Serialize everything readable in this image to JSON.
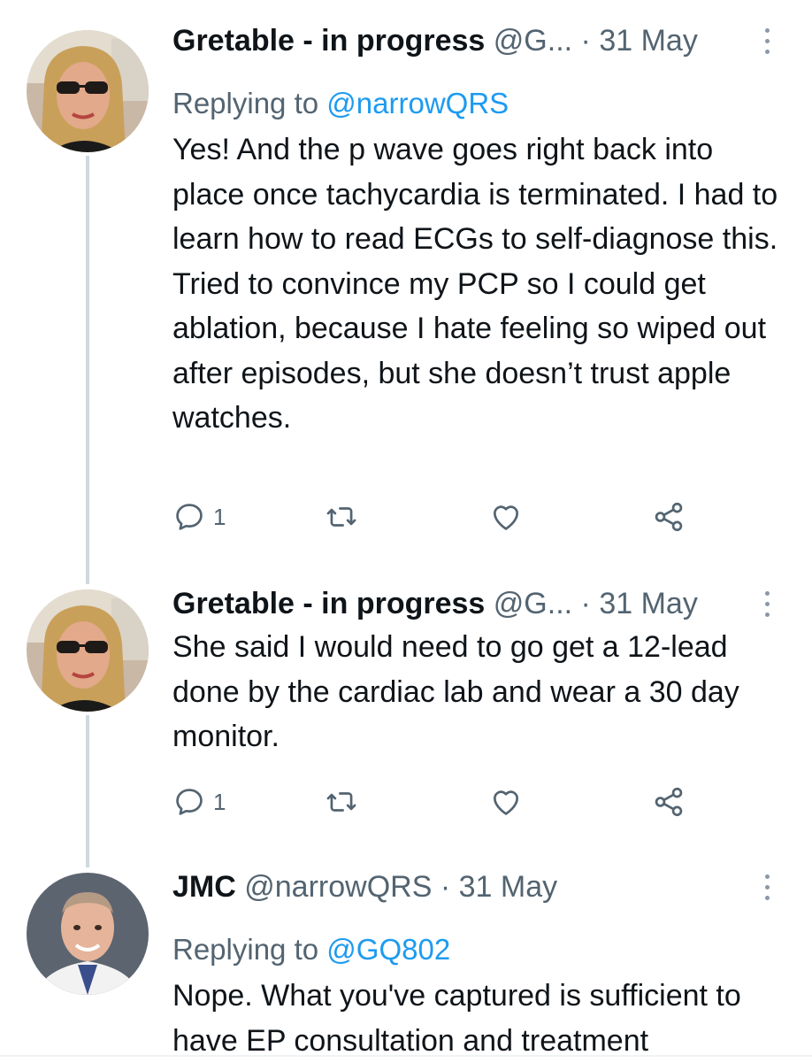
{
  "tweets": [
    {
      "author_name": "Gretable - in progress",
      "handle": "@G...",
      "separator": "·",
      "time": "31 May",
      "replying_prefix": "Replying to",
      "replying_to": "@narrowQRS",
      "text": "Yes!  And the p wave goes right back into place once tachycardia is terminated. I had to learn how to read ECGs to self-diagnose this.  Tried to convince my PCP so I could get ablation, because I hate feeling so wiped out after episodes, but she doesn’t trust apple watches.",
      "reply_count": "1",
      "avatar_icon": "woman-sunglasses-avatar"
    },
    {
      "author_name": "Gretable - in progress",
      "handle": "@G...",
      "separator": "·",
      "time": "31 May",
      "text": "She said I would need to go get a 12-lead done by the cardiac lab and wear a 30 day monitor.",
      "reply_count": "1",
      "avatar_icon": "woman-sunglasses-avatar"
    },
    {
      "author_name": "JMC",
      "handle": "@narrowQRS",
      "separator": "·",
      "time": "31 May",
      "replying_prefix": "Replying to",
      "replying_to": "@GQ802",
      "text": "Nope. What you've captured is sufficient to have EP consultation and treatment",
      "avatar_icon": "man-doctor-avatar"
    }
  ],
  "icons": {
    "reply": "speech-bubble-icon",
    "retweet": "retweet-icon",
    "like": "heart-icon",
    "share": "share-icon",
    "more": "vertical-dots-icon"
  },
  "colors": {
    "link": "#1d9bf0",
    "secondary_text": "#536471",
    "thread_line": "#cfd9de"
  }
}
